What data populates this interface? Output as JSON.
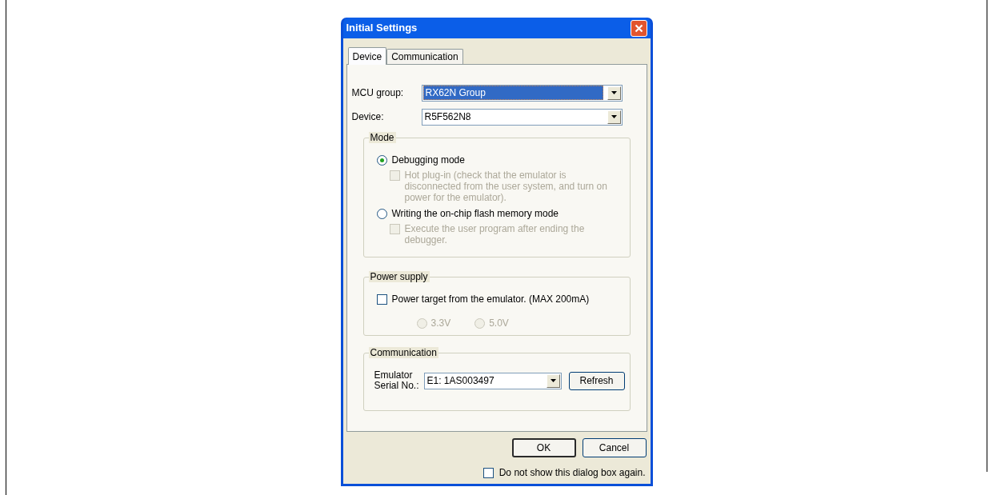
{
  "window": {
    "title": "Initial Settings"
  },
  "tabs": [
    {
      "label": "Device",
      "selected": true
    },
    {
      "label": "Communication",
      "selected": false
    }
  ],
  "fields": [
    {
      "label": "MCU group:",
      "value": "RX62N Group",
      "highlighted": true
    },
    {
      "label": "Device:",
      "value": "R5F562N8",
      "highlighted": false
    }
  ],
  "mode": {
    "title": "Mode",
    "options": [
      {
        "label": "Debugging mode",
        "selected": true,
        "suboption": {
          "label": "Hot plug-in (check that the emulator is disconnected from the user system, and turn on power for the emulator).",
          "checked": false,
          "disabled": true
        }
      },
      {
        "label": "Writing the on-chip flash memory mode",
        "selected": false,
        "suboption": {
          "label": "Execute the user program after ending the debugger.",
          "checked": false,
          "disabled": true
        }
      }
    ]
  },
  "power_supply": {
    "title": "Power supply",
    "checkbox": {
      "label": "Power target from the emulator. (MAX 200mA)",
      "checked": false
    },
    "voltages": [
      {
        "label": "3.3V",
        "selected": false,
        "disabled": true
      },
      {
        "label": "5.0V",
        "selected": false,
        "disabled": true
      }
    ]
  },
  "communication": {
    "title": "Communication",
    "label": "Emulator Serial No.:",
    "value": "E1: 1AS003497",
    "button": "Refresh"
  },
  "buttons": [
    {
      "label": "OK",
      "default": true
    },
    {
      "label": "Cancel",
      "default": false
    }
  ],
  "dont_show": {
    "label": "Do not show this dialog box again.",
    "checked": false
  }
}
